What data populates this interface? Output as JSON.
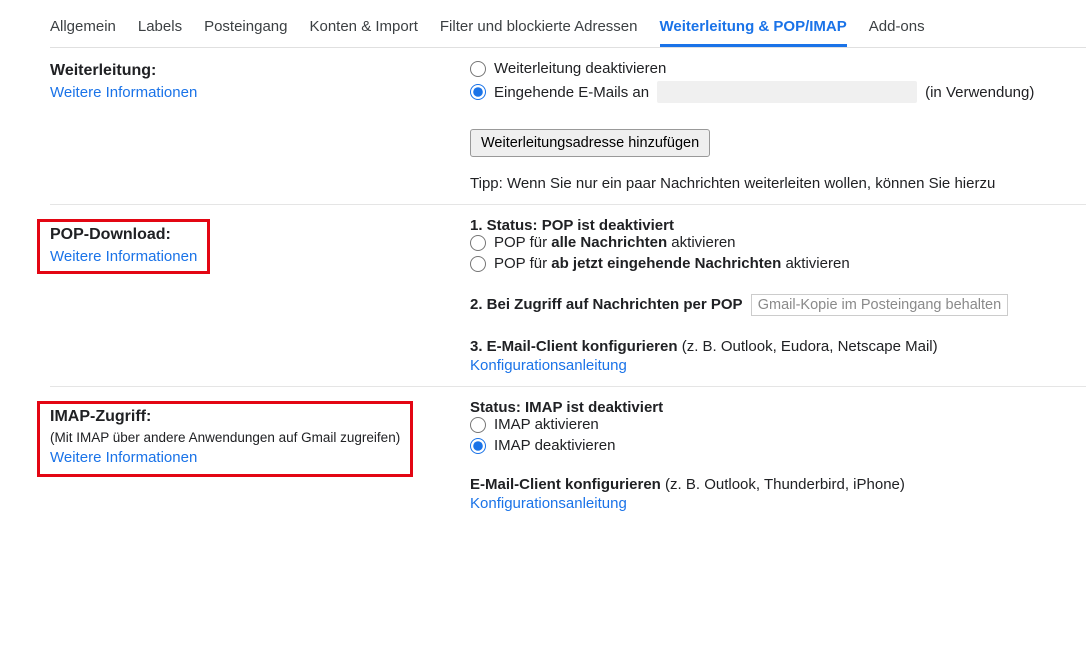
{
  "tabs": [
    {
      "label": "Allgemein"
    },
    {
      "label": "Labels"
    },
    {
      "label": "Posteingang"
    },
    {
      "label": "Konten & Import"
    },
    {
      "label": "Filter und blockierte Adressen"
    },
    {
      "label": "Weiterleitung & POP/IMAP",
      "active": true
    },
    {
      "label": "Add-ons"
    }
  ],
  "forwarding": {
    "title": "Weiterleitung:",
    "more_info": "Weitere Informationen",
    "radio_disable": "Weiterleitung deaktivieren",
    "radio_incoming": "Eingehende E-Mails an",
    "in_use": "(in Verwendung)",
    "add_button": "Weiterleitungsadresse hinzufügen",
    "tip": "Tipp: Wenn Sie nur ein paar Nachrichten weiterleiten wollen, können Sie hierzu"
  },
  "pop": {
    "title": "POP-Download:",
    "more_info": "Weitere Informationen",
    "status_label": "1. Status:",
    "status_value": "POP ist deaktiviert",
    "opt_all_pre": "POP für ",
    "opt_all_bold": "alle Nachrichten",
    "opt_all_post": " aktivieren",
    "opt_new_pre": "POP für ",
    "opt_new_bold": "ab jetzt eingehende Nachrichten",
    "opt_new_post": " aktivieren",
    "item2": "2. Bei Zugriff auf Nachrichten per POP",
    "select_placeholder": "Gmail-Kopie im Posteingang behalten",
    "item3_label": "3. E-Mail-Client konfigurieren",
    "item3_eg": " (z. B. Outlook, Eudora, Netscape Mail)",
    "config_link": "Konfigurationsanleitung"
  },
  "imap": {
    "title": "IMAP-Zugriff:",
    "subtitle": "(Mit IMAP über andere Anwendungen auf Gmail zugreifen)",
    "more_info": "Weitere Informationen",
    "status_label": "Status:",
    "status_value": "IMAP ist deaktiviert",
    "opt_enable": "IMAP aktivieren",
    "opt_disable": "IMAP deaktivieren",
    "client_label": "E-Mail-Client konfigurieren",
    "client_eg": " (z. B. Outlook, Thunderbird, iPhone)",
    "config_link": "Konfigurationsanleitung"
  }
}
